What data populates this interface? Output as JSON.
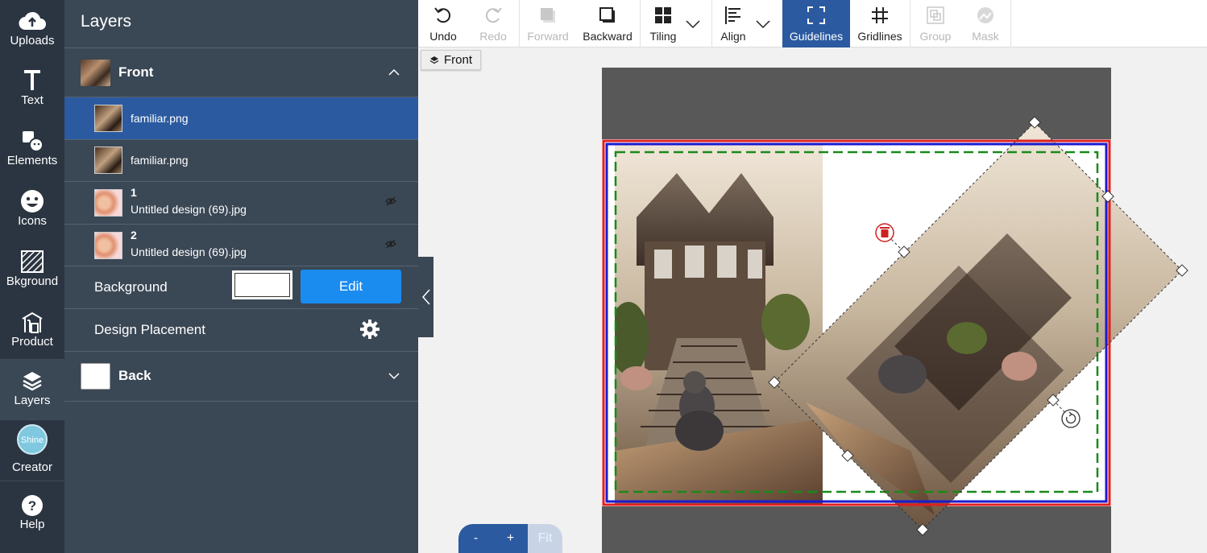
{
  "rail": {
    "items": [
      {
        "label": "Uploads",
        "icon": "cloud-upload-icon"
      },
      {
        "label": "Text",
        "icon": "text-t-icon"
      },
      {
        "label": "Elements",
        "icon": "elements-shapes-icon"
      },
      {
        "label": "Icons",
        "icon": "smiley-face-icon"
      },
      {
        "label": "Bkground",
        "icon": "background-hatch-icon"
      },
      {
        "label": "Product",
        "icon": "product-icon"
      },
      {
        "label": "Layers",
        "icon": "layers-stack-icon"
      },
      {
        "label": "Creator",
        "icon": "shine-creator-logo"
      },
      {
        "label": "Help",
        "icon": "question-circle-icon"
      }
    ],
    "logo_text": "Shine"
  },
  "panel": {
    "title": "Layers",
    "front_group": {
      "name": "Front",
      "expanded": true
    },
    "layers": [
      {
        "name": "familiar.png",
        "selected": true
      },
      {
        "name": "familiar.png",
        "selected": false
      },
      {
        "number": "1",
        "name": "Untitled design (69).jpg",
        "hidden": true
      },
      {
        "number": "2",
        "name": "Untitled design (69).jpg",
        "hidden": true
      }
    ],
    "background_label": "Background",
    "background_color": "#ffffff",
    "edit_label": "Edit",
    "design_placement_label": "Design Placement",
    "back_group": {
      "name": "Back",
      "expanded": false
    }
  },
  "toolbar": {
    "tools": [
      {
        "label": "Undo",
        "icon": "undo-icon",
        "state": "enabled"
      },
      {
        "label": "Redo",
        "icon": "redo-icon",
        "state": "disabled"
      },
      {
        "label": "Forward",
        "icon": "bring-forward-icon",
        "state": "disabled"
      },
      {
        "label": "Backward",
        "icon": "send-backward-icon",
        "state": "enabled"
      },
      {
        "label": "Tiling",
        "icon": "tiling-grid-icon",
        "state": "enabled"
      },
      {
        "label": "Align",
        "icon": "align-left-icon",
        "state": "enabled"
      },
      {
        "label": "Guidelines",
        "icon": "guidelines-corners-icon",
        "state": "active"
      },
      {
        "label": "Gridlines",
        "icon": "gridlines-hash-icon",
        "state": "enabled"
      },
      {
        "label": "Group",
        "icon": "group-icon",
        "state": "disabled"
      },
      {
        "label": "Mask",
        "icon": "mask-icon",
        "state": "disabled"
      }
    ]
  },
  "canvas": {
    "side_tag": "Front"
  },
  "zoom": {
    "minus": "-",
    "plus": "+",
    "fit": "Fit"
  },
  "colors": {
    "rail_bg": "#2b3541",
    "panel_bg": "#3a4755",
    "selected": "#2b5aa0",
    "edit_button": "#1a8cf0",
    "bleed_red": "#e02020",
    "trim_blue": "#1a1ad0",
    "safe_green": "#1a8a1a"
  }
}
